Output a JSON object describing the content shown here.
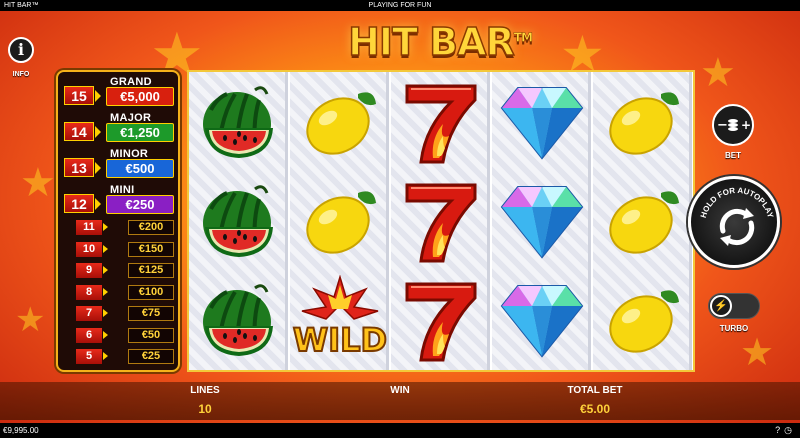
{
  "topbar": {
    "title": "HIT BAR™",
    "mode": "PLAYING FOR FUN"
  },
  "info": {
    "icon": "info-icon",
    "label": "INFO"
  },
  "logo": {
    "text": "HIT BAR",
    "tm": "TM"
  },
  "jackpots": [
    {
      "number": "15",
      "name": "GRAND",
      "value": "€5,000",
      "color": "#d8200e"
    },
    {
      "number": "14",
      "name": "MAJOR",
      "value": "€1,250",
      "color": "#1d9a2a"
    },
    {
      "number": "13",
      "name": "MINOR",
      "value": "€500",
      "color": "#1866d8"
    },
    {
      "number": "12",
      "name": "MINI",
      "value": "€250",
      "color": "#8a1fc4"
    }
  ],
  "prizes": [
    {
      "number": "11",
      "value": "€200"
    },
    {
      "number": "10",
      "value": "€150"
    },
    {
      "number": "9",
      "value": "€125"
    },
    {
      "number": "8",
      "value": "€100"
    },
    {
      "number": "7",
      "value": "€75"
    },
    {
      "number": "6",
      "value": "€50"
    },
    {
      "number": "5",
      "value": "€25"
    }
  ],
  "reels": [
    [
      "watermelon",
      "watermelon",
      "watermelon"
    ],
    [
      "lemon",
      "lemon",
      "wild"
    ],
    [
      "seven",
      "seven",
      "seven"
    ],
    [
      "diamond",
      "diamond",
      "diamond"
    ],
    [
      "lemon",
      "lemon",
      "lemon"
    ]
  ],
  "wild_text": "WILD",
  "controls": {
    "bet_label": "BET",
    "autoplay_label": "HOLD FOR AUTOPLAY",
    "turbo_label": "TURBO"
  },
  "bottom": {
    "lines_label": "LINES",
    "lines_value": "10",
    "win_label": "WIN",
    "total_bet_label": "TOTAL BET",
    "total_bet_value": "€5.00"
  },
  "status": {
    "balance": "€9,995.00"
  }
}
